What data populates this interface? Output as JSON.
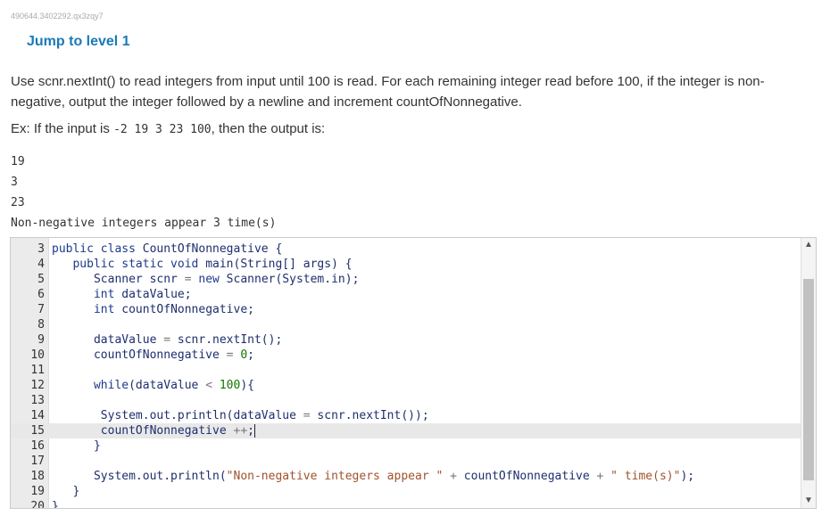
{
  "watermark": "490644.3402292.qx3zqy7",
  "jump_link": "Jump to level 1",
  "instructions": "Use scnr.nextInt() to read integers from input until 100 is read. For each remaining integer read before 100, if the integer is non-negative, output the integer followed by a newline and increment countOfNonnegative.",
  "example": {
    "prefix": "Ex: If the input is ",
    "input": "-2 19 3 23 100",
    "suffix": ", then the output is:"
  },
  "expected_output": [
    "19",
    "3",
    "23",
    "Non-negative integers appear 3 time(s)"
  ],
  "editor": {
    "active_line": 15,
    "lines": [
      {
        "n": "3",
        "html": "<span class=\"kw\">public class</span> CountOfNonnegative {"
      },
      {
        "n": "4",
        "html": "   <span class=\"kw\">public static void</span> main(String[] args) {"
      },
      {
        "n": "5",
        "html": "      Scanner scnr <span class=\"op\">=</span> <span class=\"kw\">new</span> Scanner(System.in);"
      },
      {
        "n": "6",
        "html": "      <span class=\"kw\">int</span> dataValue;"
      },
      {
        "n": "7",
        "html": "      <span class=\"kw\">int</span> countOfNonnegative;"
      },
      {
        "n": "8",
        "html": ""
      },
      {
        "n": "9",
        "html": "      dataValue <span class=\"op\">=</span> scnr.nextInt();"
      },
      {
        "n": "10",
        "html": "      countOfNonnegative <span class=\"op\">=</span> <span class=\"num\">0</span>;"
      },
      {
        "n": "11",
        "html": ""
      },
      {
        "n": "12",
        "html": "      <span class=\"kw\">while</span>(dataValue <span class=\"op\">&lt;</span> <span class=\"num\">100</span>){"
      },
      {
        "n": "13",
        "html": ""
      },
      {
        "n": "14",
        "html": "       System.out.println(dataValue <span class=\"op\">=</span> scnr.nextInt());"
      },
      {
        "n": "15",
        "html": "       countOfNonnegative <span class=\"op\">++</span>;<span class=\"cursor\"></span>"
      },
      {
        "n": "16",
        "html": "      }"
      },
      {
        "n": "17",
        "html": ""
      },
      {
        "n": "18",
        "html": "      System.out.println(<span class=\"str\">\"Non-negative integers appear \"</span> <span class=\"op\">+</span> countOfNonnegative <span class=\"op\">+</span> <span class=\"str\">\" time(s)\"</span>);"
      },
      {
        "n": "19",
        "html": "   }"
      },
      {
        "n": "20",
        "html": "}"
      }
    ]
  },
  "scrollbar": {
    "up_icon": "chevron-up-icon",
    "down_icon": "chevron-down-icon"
  }
}
